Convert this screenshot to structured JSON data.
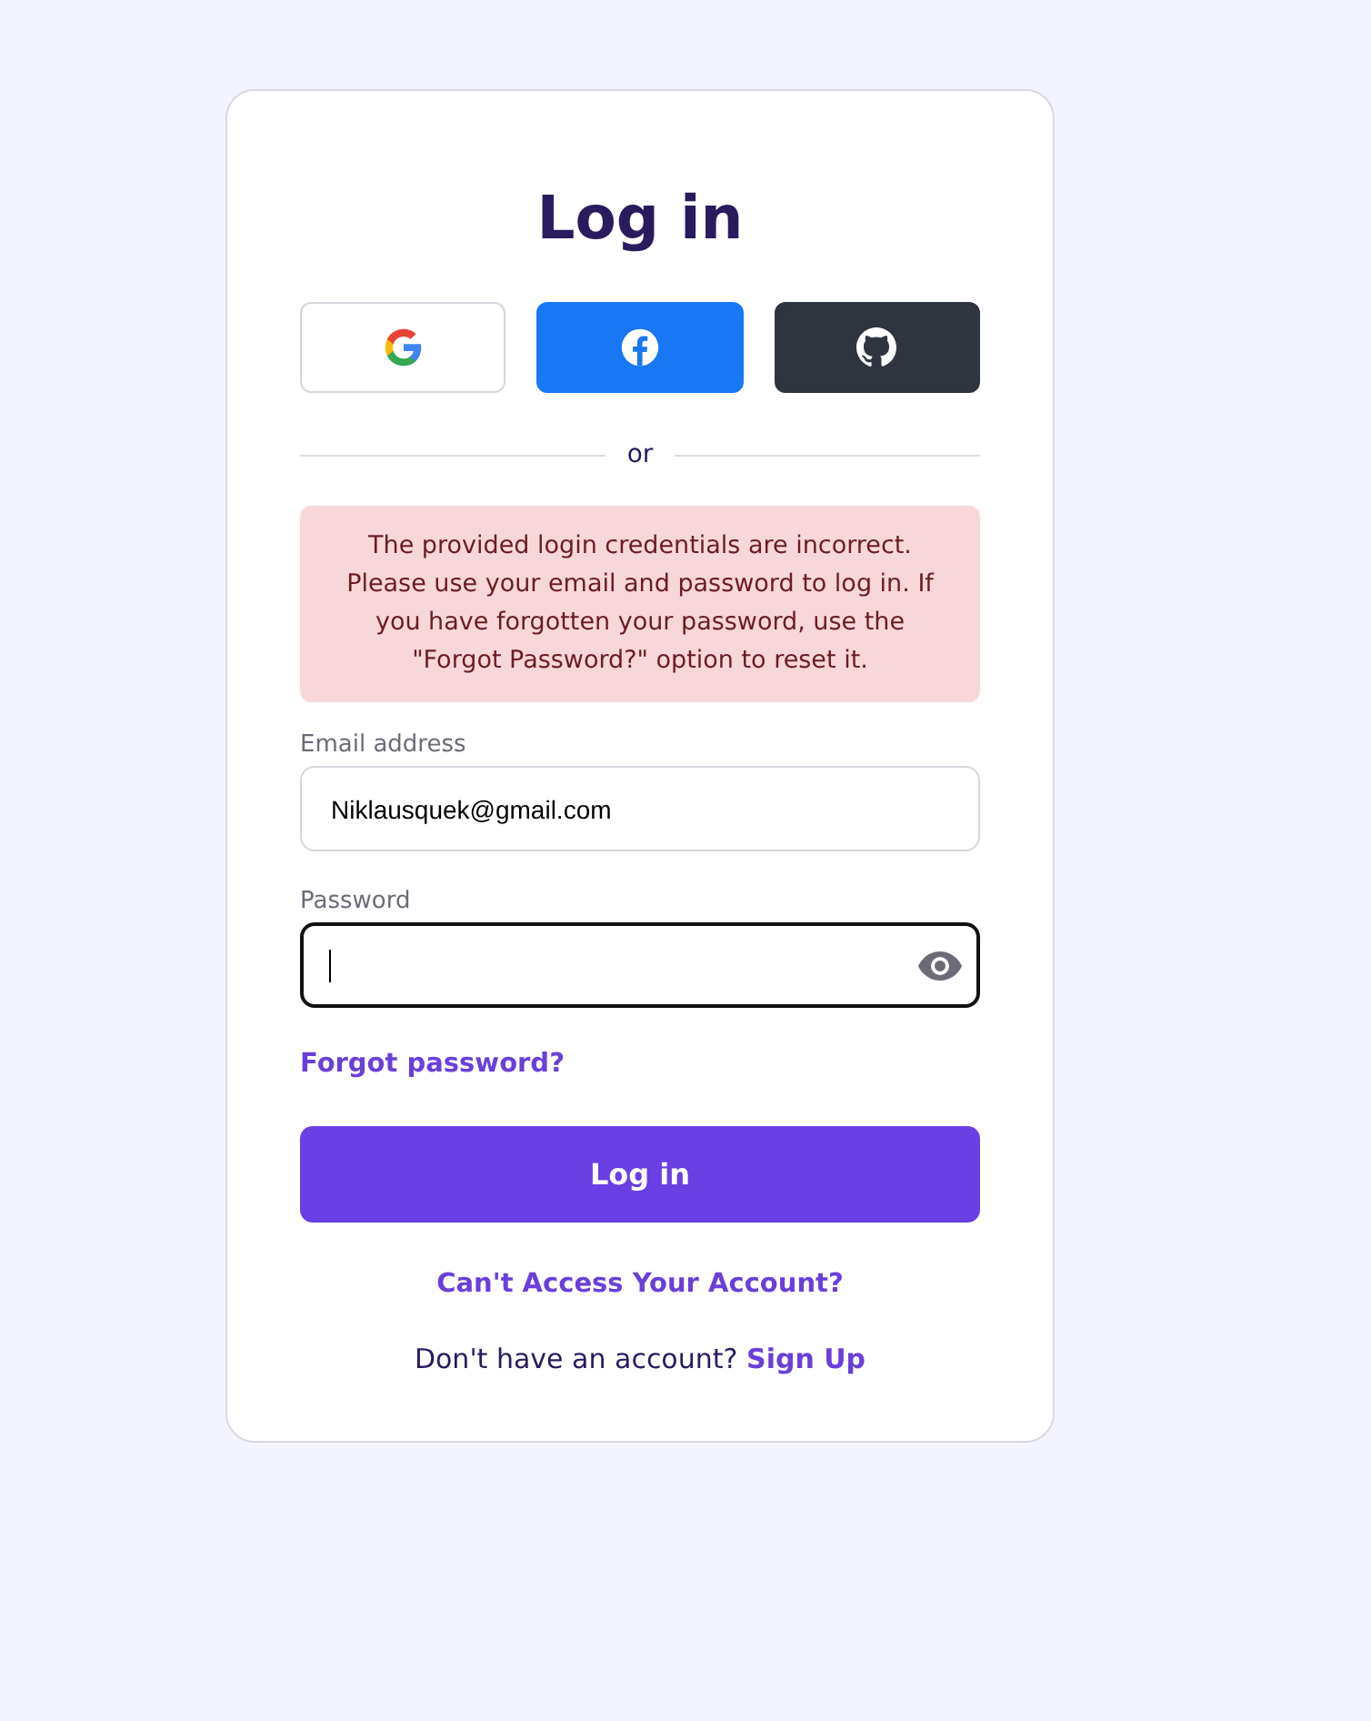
{
  "title": "Log in",
  "social_buttons": [
    {
      "kind": "google"
    },
    {
      "kind": "facebook"
    },
    {
      "kind": "github"
    }
  ],
  "divider": "or",
  "error": "The provided login credentials are incorrect. Please use your email and password to log in. If you have forgotten your password, use the \"Forgot Password?\" option to reset it.",
  "fields": [
    {
      "kind": "email",
      "label": "Email address",
      "value": "Niklausquek@gmail.com",
      "focused": false
    },
    {
      "kind": "password",
      "label": "Password",
      "focused": true
    }
  ],
  "forgot_link": "Forgot password?",
  "submit": "Log in",
  "help_link": "Can't Access Your Account?",
  "signup": {
    "prompt": "Don't have an account?",
    "link": "Sign Up"
  }
}
